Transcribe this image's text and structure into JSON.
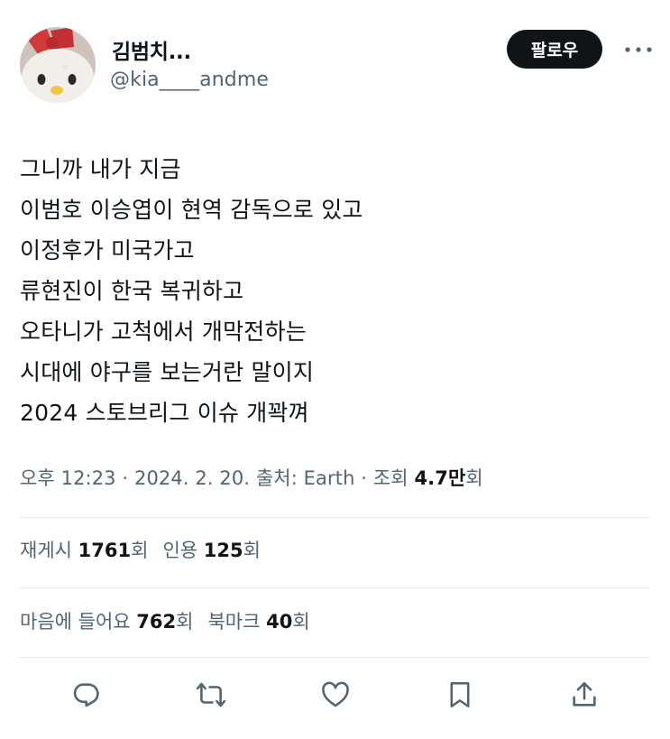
{
  "author": {
    "display_name": "김범치...",
    "handle": "@kia____andme"
  },
  "follow_button": {
    "label": "팔로우"
  },
  "tweet": {
    "lines": [
      "그니까 내가 지금",
      "이범호 이승엽이 현역 감독으로 있고",
      "이정후가 미국가고",
      "류현진이 한국 복귀하고",
      "오타니가 고척에서 개막전하는",
      "시대에 야구를 보는거란 말이지",
      "2024 스토브리그 이슈 개꽉껴"
    ]
  },
  "meta": {
    "time": "오후 12:23",
    "date": "2024. 2. 20.",
    "source": "출처: Earth",
    "views_label": "조회",
    "views_count": "4.7만",
    "views_suffix": "회",
    "separator": "·"
  },
  "stats": {
    "retweets_label": "재게시",
    "retweets_count": "1761",
    "retweets_suffix": "회",
    "quotes_label": "인용",
    "quotes_count": "125",
    "quotes_suffix": "회",
    "likes_label": "마음에 들어요",
    "likes_count": "762",
    "likes_suffix": "회",
    "bookmarks_label": "북마크",
    "bookmarks_count": "40",
    "bookmarks_suffix": "회"
  },
  "icons": {
    "reply": "reply-icon",
    "retweet": "retweet-icon",
    "like": "heart-icon",
    "bookmark": "bookmark-icon",
    "share": "share-icon",
    "more": "more-icon"
  },
  "colors": {
    "text_primary": "#0f1419",
    "text_secondary": "#536471",
    "divider": "#e7e9ea",
    "follow_bg": "#0f1419"
  }
}
